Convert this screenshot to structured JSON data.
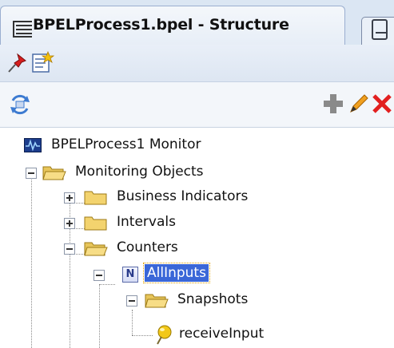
{
  "tab": {
    "title": "BPELProcess1.bpel - Structure"
  },
  "toolbar": {
    "pin_icon": "pin-icon",
    "properties_icon": "properties-icon",
    "refresh_icon": "refresh-icon",
    "add_icon": "add-icon",
    "edit_icon": "edit-icon",
    "delete_icon": "delete-icon"
  },
  "tree": {
    "root": "BPELProcess1 Monitor",
    "monitoring_objects": "Monitoring Objects",
    "business_indicators": "Business Indicators",
    "intervals": "Intervals",
    "counters": "Counters",
    "all_inputs_badge": "N",
    "all_inputs": "AllInputs",
    "snapshots": "Snapshots",
    "receive_input": "receiveInput"
  },
  "colors": {
    "selection": "#3a67d8",
    "folder": "#f1d36d",
    "delete": "#e22020"
  }
}
